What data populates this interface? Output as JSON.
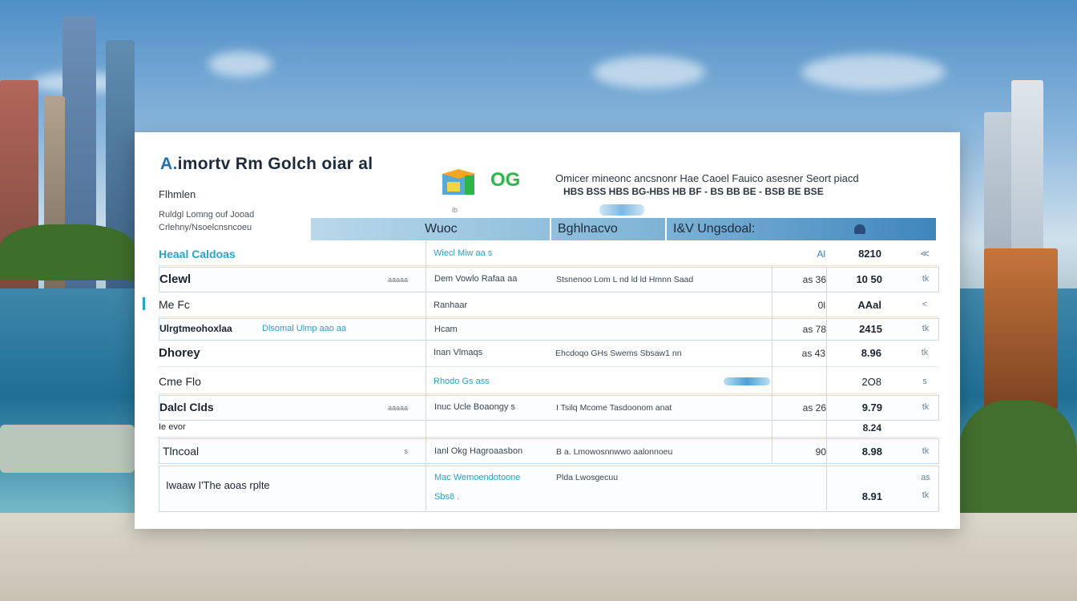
{
  "header": {
    "title": "A.imortv Rm Golch oiar al",
    "subtitle": "Flhmlen",
    "note1": "Ruldgl Lomng ouf Jooad",
    "note2": "Crlehny/Nsoelcnsncoeu",
    "brand_mark": "OG",
    "right_line1": "Omicer mineonc ancsnonr Hae Caoel Fauico asesner Seort piacd",
    "right_line2": "HBS BSS HBS BG-HBS HB BF - BS BB BE - BSB BE BSE",
    "tiny_mark": "ib"
  },
  "columns": {
    "col1": "Wuoc",
    "col2": "Bghlnacvo",
    "col3": "I&V Ungsdoal:"
  },
  "rows": [
    {
      "name": "Heaal Caldoas",
      "small": "",
      "mid": "Wiecl Miw aa s",
      "desc": "",
      "v1": "Al",
      "v2": "8210",
      "icon": "≪"
    },
    {
      "name": "Clewl",
      "small": "aaaaa",
      "mid": "Dem Vowlo Rafaa aa",
      "desc": "Stsnenoo Lom L nd ld ld Hmnn Saad",
      "v1": "as 36",
      "v2": "10 50",
      "icon": "tk"
    },
    {
      "name": "Me Fc",
      "small": "",
      "mid": "Ranhaar",
      "desc": "",
      "v1": "0l",
      "v2": "AAal",
      "icon": "<"
    },
    {
      "name": "Ulrgtmeohoxlaa",
      "small": "",
      "mid": "Hcam",
      "desc": "",
      "v1": "as 78",
      "v2": "2415",
      "icon": "tk",
      "extra": "Dlsomal Ulmp aao aa"
    },
    {
      "name": "Dhorey",
      "small": "",
      "mid": "Inan Vlmaqs",
      "desc": "Ehcdoqo GHs Swems Sbsaw1 nn",
      "v1": "as 43",
      "v2": "8.96",
      "icon": "tk"
    },
    {
      "name": "Cme Flo",
      "small": "",
      "mid": "Rhodo Gs ass",
      "desc": "",
      "v1": "",
      "v2": "2O8",
      "icon": "s"
    },
    {
      "name": "Dalcl Clds",
      "small": "aaaaa",
      "mid": "Inuc Ucle Boaongy s",
      "desc": "I Tsilq Mcome Tasdoonom anat",
      "v1": "as 26",
      "v2": "9.79",
      "icon": "tk"
    },
    {
      "name": "Ie evor",
      "small": "",
      "mid": "",
      "desc": "",
      "v1": "",
      "v2": "8.24",
      "icon": ""
    },
    {
      "name": "Tlncoal",
      "small": "s",
      "mid": "Ianl Okg Hagroaasbon",
      "desc": "B a. Lmowosnnwwo aalonnoeu",
      "v1": "90",
      "v2": "8.98",
      "icon": "tk"
    },
    {
      "name": "Iwaaw I'The aoas rplte",
      "small": "",
      "mid": "Mac Wemoendotoone",
      "mid2": "Sbs8 .",
      "desc": "Plda Lwosgecuu",
      "v1": "",
      "v2": "8.91",
      "icon": "tk",
      "icon2": "as"
    }
  ]
}
